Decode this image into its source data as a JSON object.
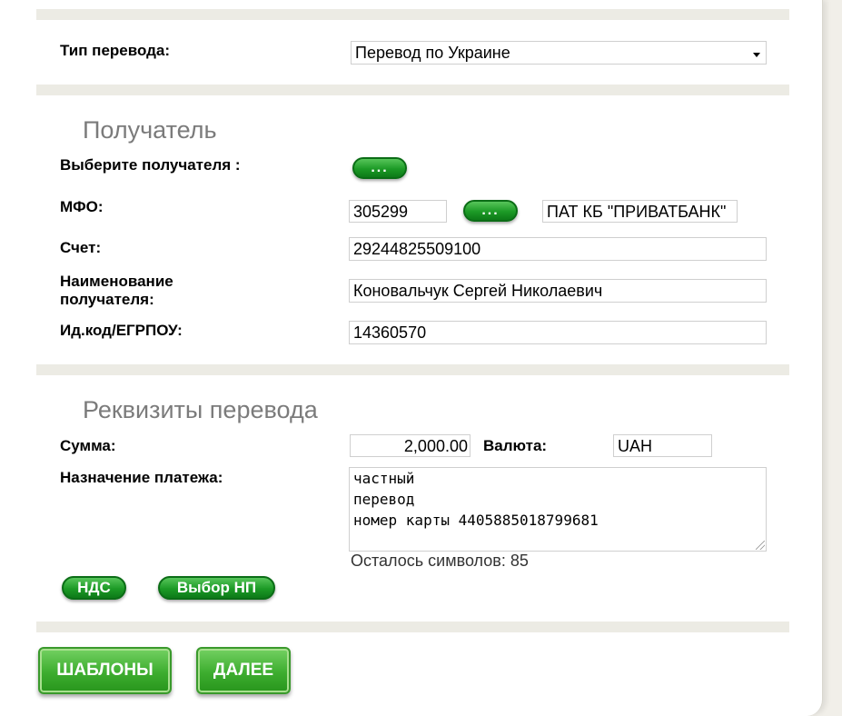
{
  "transfer_type": {
    "label": "Тип перевода:",
    "selected": "Перевод по Украине"
  },
  "recipient": {
    "title": "Получатель",
    "choose_label": "Выберите получателя :",
    "choose_button": "...",
    "mfo_label": "МФО:",
    "mfo_value": "305299",
    "mfo_button": "...",
    "bank_name": "ПАТ КБ \"ПРИВАТБАНК\"",
    "account_label": "Счет:",
    "account_value": "29244825509100",
    "name_label_line1": "Наименование",
    "name_label_line2": "получателя:",
    "name_value": "Коновальчук Сергей Николаевич",
    "code_label": "Ид.код/ЕГРПОУ:",
    "code_value": "14360570"
  },
  "details": {
    "title": "Реквизиты перевода",
    "amount_label": "Сумма:",
    "amount_value": "2,000.00",
    "currency_label": "Валюта:",
    "currency_value": "UAH",
    "purpose_label": "Назначение платежа:",
    "purpose_value": "частный\nперевод\nномер карты 4405885018799681",
    "chars_left": "Осталось символов: 85",
    "vat_button": "НДС",
    "tax_button": "Выбор НП"
  },
  "footer": {
    "templates_button": "ШАБЛОНЫ",
    "next_button": "ДАЛЕЕ"
  }
}
